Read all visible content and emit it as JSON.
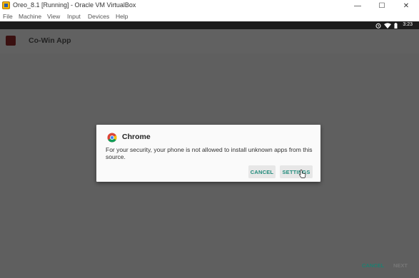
{
  "window": {
    "title": "Oreo_8.1 [Running] - Oracle VM VirtualBox",
    "controls": {
      "minimize": "—",
      "maximize": "☐",
      "close": "✕"
    }
  },
  "menu": [
    "File",
    "Machine",
    "View",
    "Input",
    "Devices",
    "Help"
  ],
  "status_bar": {
    "time": "3:23",
    "icons": [
      "alarm-icon",
      "wifi-icon",
      "battery-icon"
    ]
  },
  "app_bar": {
    "title": "Co-Win App"
  },
  "dialog": {
    "title": "Chrome",
    "message": "For your security, your phone is not allowed to install unknown apps from this source.",
    "cancel_label": "CANCEL",
    "settings_label": "SETTINGS"
  },
  "bottom_nav": {
    "cancel_label": "CANCEL",
    "next_label": "NEXT"
  },
  "colors": {
    "accent": "#1f8a7a",
    "scrim": "#5f5f5f",
    "status_bar": "#1c1c1c"
  }
}
